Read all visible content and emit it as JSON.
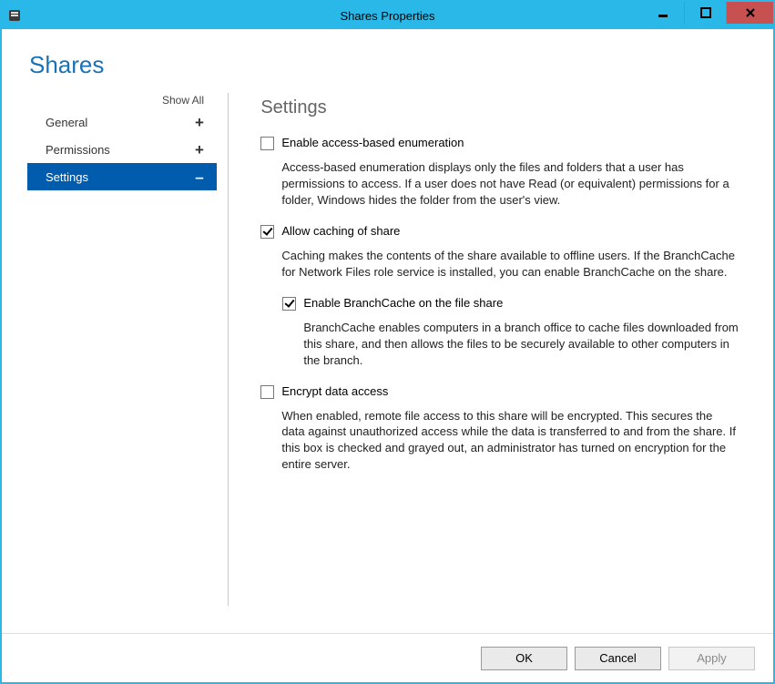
{
  "window": {
    "title": "Shares Properties"
  },
  "page": {
    "heading": "Shares"
  },
  "sidebar": {
    "show_all_label": "Show All",
    "items": [
      {
        "label": "General",
        "marker": "+",
        "selected": false
      },
      {
        "label": "Permissions",
        "marker": "+",
        "selected": false
      },
      {
        "label": "Settings",
        "marker": "–",
        "selected": true
      }
    ]
  },
  "content": {
    "section_title": "Settings",
    "options": {
      "enable_abe": {
        "label": "Enable access-based enumeration",
        "checked": false,
        "desc": "Access-based enumeration displays only the files and folders that a user has permissions to access. If a user does not have Read (or equivalent) permissions for a folder, Windows hides the folder from the user's view."
      },
      "allow_caching": {
        "label": "Allow caching of share",
        "checked": true,
        "desc": "Caching makes the contents of the share available to offline users. If the BranchCache for Network Files role service is installed, you can enable BranchCache on the share."
      },
      "enable_branchcache": {
        "label": "Enable BranchCache on the file share",
        "checked": true,
        "desc": "BranchCache enables computers in a branch office to cache files downloaded from this share, and then allows the files to be securely available to other computers in the branch."
      },
      "encrypt_data": {
        "label": "Encrypt data access",
        "checked": false,
        "desc": "When enabled, remote file access to this share will be encrypted. This secures the data against unauthorized access while the data is transferred to and from the share. If this box is checked and grayed out, an administrator has turned on encryption for the entire server."
      }
    }
  },
  "buttons": {
    "ok": "OK",
    "cancel": "Cancel",
    "apply": "Apply"
  }
}
